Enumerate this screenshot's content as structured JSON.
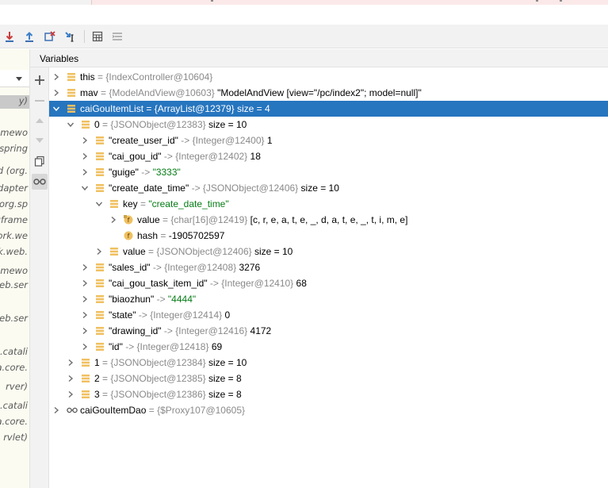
{
  "colors": {
    "selection": "#2675bf",
    "field_icon": "#f0c060",
    "string_value": "#067d17",
    "object_ref": "#8a8a8a"
  },
  "toolbar": {
    "buttons": [
      {
        "icon": "step-into-icon"
      },
      {
        "icon": "step-out-icon"
      },
      {
        "icon": "drop-frame-icon"
      },
      {
        "icon": "run-to-cursor-icon"
      },
      {
        "icon": "evaluate-expression-icon"
      },
      {
        "icon": "trace-current-stream-icon"
      }
    ]
  },
  "variables_panel": {
    "title": "Variables"
  },
  "frames_fragments": [
    "y)",
    "amewo",
    "spring",
    "d (org.",
    "dapter",
    "org.sp",
    "gframe",
    "vork.we",
    "k.web.",
    "amewo",
    "eb.ser",
    "web.ser",
    "e.catali",
    "a.core.",
    "rver)",
    "e.catali",
    "a.core.",
    "rvlet)"
  ],
  "sidebar": {
    "buttons": [
      {
        "icon": "plus-icon"
      },
      {
        "icon": "minus-icon"
      },
      {
        "icon": "up-icon"
      },
      {
        "icon": "down-icon"
      },
      {
        "icon": "copy-icon"
      },
      {
        "icon": "watches-glasses-icon"
      }
    ]
  },
  "variables": [
    {
      "indent": 0,
      "arrow": "collapsed",
      "icon": "field",
      "name": "this",
      "sep": " = ",
      "ref": "{IndexController@10604}",
      "value": "",
      "size": ""
    },
    {
      "indent": 0,
      "arrow": "collapsed",
      "icon": "field",
      "name": "mav",
      "sep": " = ",
      "ref": "{ModelAndView@10603}",
      "value": "\"ModelAndView [view=\"/pc/index2\"; model=null]\"",
      "size": ""
    },
    {
      "indent": 0,
      "arrow": "expanded",
      "icon": "field",
      "name": "caiGouItemList",
      "sep": " = ",
      "ref": "{ArrayList@12379}",
      "value": "",
      "size": "size = 4",
      "selected": true
    },
    {
      "indent": 1,
      "arrow": "expanded",
      "icon": "field",
      "name": "0",
      "sep": " = ",
      "ref": "{JSONObject@12383}",
      "value": "",
      "size": "size = 10"
    },
    {
      "indent": 2,
      "arrow": "collapsed",
      "icon": "field",
      "name": "\"create_user_id\"",
      "sep": " -> ",
      "ref": "{Integer@12400}",
      "value": "1",
      "size": ""
    },
    {
      "indent": 2,
      "arrow": "collapsed",
      "icon": "field",
      "name": "\"cai_gou_id\"",
      "sep": " -> ",
      "ref": "{Integer@12402}",
      "value": "18",
      "size": ""
    },
    {
      "indent": 2,
      "arrow": "collapsed",
      "icon": "field",
      "name": "\"guige\"",
      "sep": " -> ",
      "ref": "",
      "value": "\"3333\"",
      "value_kind": "string",
      "size": ""
    },
    {
      "indent": 2,
      "arrow": "expanded",
      "icon": "field",
      "name": "\"create_date_time\"",
      "sep": " -> ",
      "ref": "{JSONObject@12406}",
      "value": "",
      "size": "size = 10"
    },
    {
      "indent": 3,
      "arrow": "expanded",
      "icon": "field",
      "name": "key",
      "sep": " = ",
      "ref": "",
      "value": "\"create_date_time\"",
      "value_kind": "string",
      "size": ""
    },
    {
      "indent": 4,
      "arrow": "collapsed",
      "icon": "f-locked",
      "name": "value",
      "sep": " = ",
      "ref": "{char[16]@12419}",
      "value": "[c, r, e, a, t, e, _, d, a, t, e, _, t, i, m, e]",
      "size": ""
    },
    {
      "indent": 4,
      "arrow": "none",
      "icon": "f",
      "name": "hash",
      "sep": " = ",
      "ref": "",
      "value": "-1905702597",
      "size": ""
    },
    {
      "indent": 3,
      "arrow": "collapsed",
      "icon": "field",
      "name": "value",
      "sep": " = ",
      "ref": "{JSONObject@12406}",
      "value": "",
      "size": "size = 10"
    },
    {
      "indent": 2,
      "arrow": "collapsed",
      "icon": "field",
      "name": "\"sales_id\"",
      "sep": " -> ",
      "ref": "{Integer@12408}",
      "value": "3276",
      "size": ""
    },
    {
      "indent": 2,
      "arrow": "collapsed",
      "icon": "field",
      "name": "\"cai_gou_task_item_id\"",
      "sep": " -> ",
      "ref": "{Integer@12410}",
      "value": "68",
      "size": ""
    },
    {
      "indent": 2,
      "arrow": "collapsed",
      "icon": "field",
      "name": "\"biaozhun\"",
      "sep": " -> ",
      "ref": "",
      "value": "\"4444\"",
      "value_kind": "string",
      "size": ""
    },
    {
      "indent": 2,
      "arrow": "collapsed",
      "icon": "field",
      "name": "\"state\"",
      "sep": " -> ",
      "ref": "{Integer@12414}",
      "value": "0",
      "size": ""
    },
    {
      "indent": 2,
      "arrow": "collapsed",
      "icon": "field",
      "name": "\"drawing_id\"",
      "sep": " -> ",
      "ref": "{Integer@12416}",
      "value": "4172",
      "size": ""
    },
    {
      "indent": 2,
      "arrow": "collapsed",
      "icon": "field",
      "name": "\"id\"",
      "sep": " -> ",
      "ref": "{Integer@12418}",
      "value": "69",
      "size": ""
    },
    {
      "indent": 1,
      "arrow": "collapsed",
      "icon": "field",
      "name": "1",
      "sep": " = ",
      "ref": "{JSONObject@12384}",
      "value": "",
      "size": "size = 10"
    },
    {
      "indent": 1,
      "arrow": "collapsed",
      "icon": "field",
      "name": "2",
      "sep": " = ",
      "ref": "{JSONObject@12385}",
      "value": "",
      "size": "size = 8"
    },
    {
      "indent": 1,
      "arrow": "collapsed",
      "icon": "field",
      "name": "3",
      "sep": " = ",
      "ref": "{JSONObject@12386}",
      "value": "",
      "size": "size = 8"
    },
    {
      "indent": 0,
      "arrow": "collapsed",
      "icon": "glasses",
      "name": "caiGouItemDao",
      "sep": " = ",
      "ref": "{$Proxy107@10605}",
      "value": "",
      "size": ""
    }
  ]
}
